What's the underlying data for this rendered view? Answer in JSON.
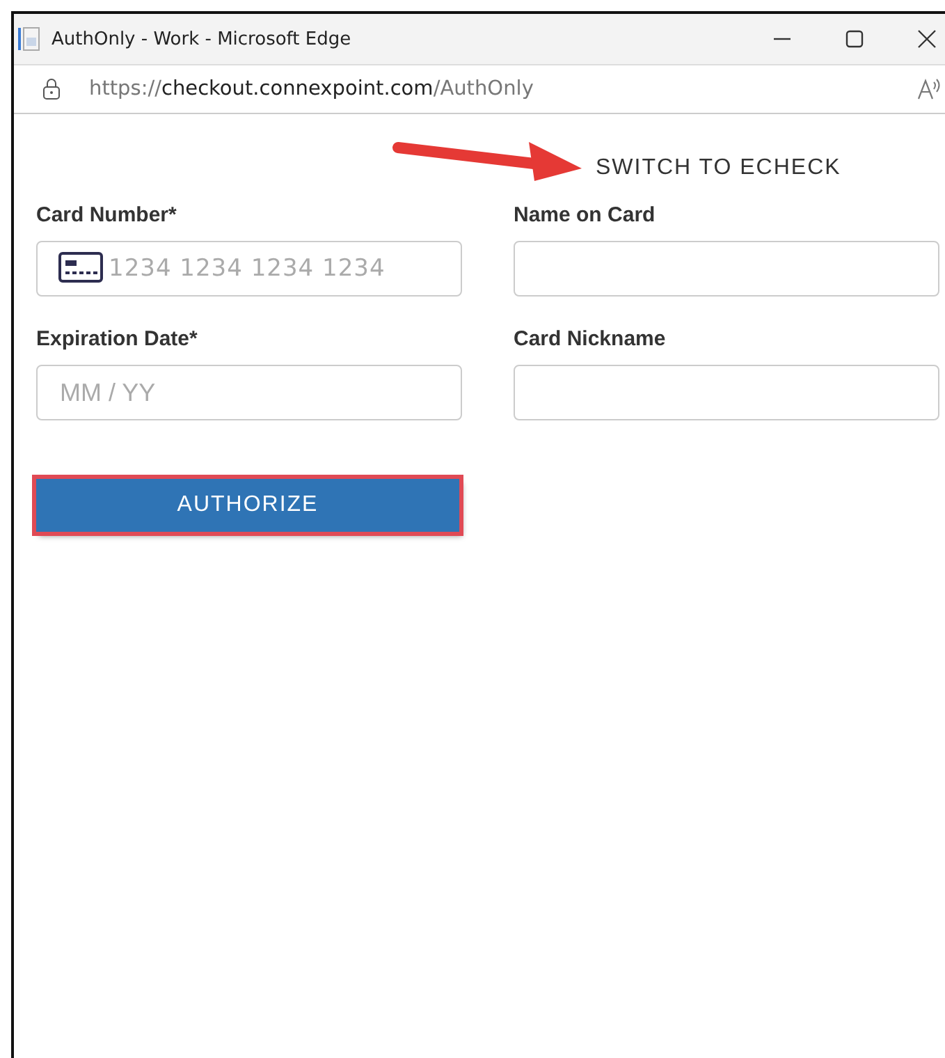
{
  "window": {
    "title": "AuthOnly - Work - Microsoft Edge"
  },
  "address_bar": {
    "url_prefix": "https://",
    "url_host": "checkout.connexpoint.com",
    "url_path": "/AuthOnly"
  },
  "switch_link": "SWITCH TO ECHECK",
  "annotation": {
    "kind": "arrow"
  },
  "fields": [
    {
      "label": "Card Number*",
      "placeholder": "1234 1234 1234 1234",
      "kind": "card"
    },
    {
      "label": "Name on Card",
      "kind": "text"
    },
    {
      "label": "Expiration Date*",
      "placeholder": "MM / YY",
      "kind": "text"
    },
    {
      "label": "Card Nickname",
      "kind": "text"
    }
  ],
  "authorize_button": {
    "label": "AUTHORIZE",
    "highlighted": true
  }
}
